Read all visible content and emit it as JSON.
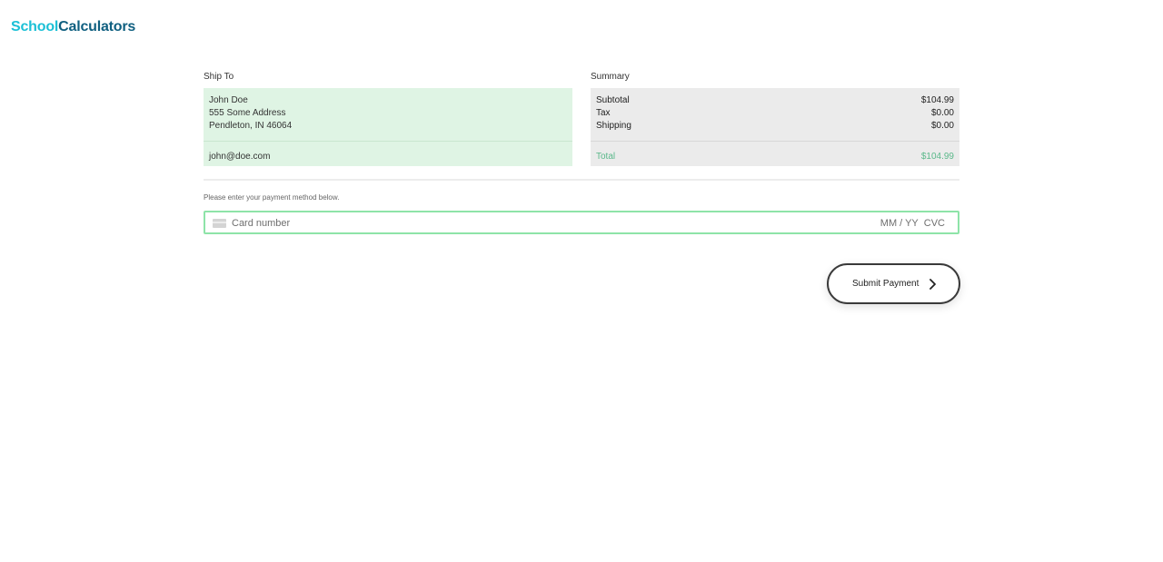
{
  "header": {
    "logo_part1": "School",
    "logo_part2": "Calculators"
  },
  "ship_to": {
    "title": "Ship To",
    "name": "John Doe",
    "address": "555 Some Address",
    "city_line": "Pendleton, IN 46064",
    "email": "john@doe.com"
  },
  "summary": {
    "title": "Summary",
    "subtotal_label": "Subtotal",
    "subtotal_value": "$104.99",
    "tax_label": "Tax",
    "tax_value": "$0.00",
    "shipping_label": "Shipping",
    "shipping_value": "$0.00",
    "total_label": "Total",
    "total_value": "$104.99",
    "total_color": "#5ab88a"
  },
  "payment": {
    "hint": "Please enter your payment method below.",
    "card_placeholder": "Card number",
    "expiry_placeholder": "MM / YY",
    "cvc_placeholder": "CVC",
    "card_icon": "credit-card-icon"
  },
  "actions": {
    "submit_label": "Submit Payment",
    "submit_icon": "chevron-right-icon"
  },
  "colors": {
    "accent": "#1cc0d6",
    "brand": "#0f5f80",
    "ship_panel_bg": "#dff4e4",
    "summary_panel_bg": "#ebebeb",
    "field_border": "#8ee4a8"
  }
}
